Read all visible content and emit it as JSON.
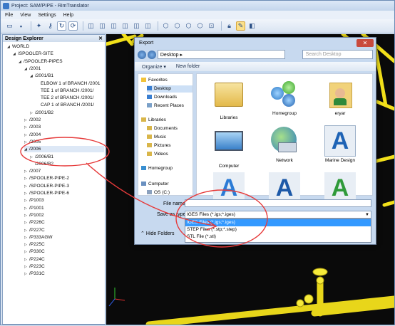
{
  "window": {
    "title": "Project: SAM/PIPE - RimTranslator"
  },
  "menu": [
    "File",
    "View",
    "Settings",
    "Help"
  ],
  "explorer": {
    "title": "Design Explorer",
    "pin": "✕",
    "tree": [
      {
        "label": "WORLD",
        "depth": 0,
        "arrow": "◢"
      },
      {
        "label": "/SPOOLER-SITE",
        "depth": 1,
        "arrow": "◢"
      },
      {
        "label": "/SPOOLER-PIPES",
        "depth": 2,
        "arrow": "◢"
      },
      {
        "label": "/2001",
        "depth": 3,
        "arrow": "◢"
      },
      {
        "label": "/2001/B1",
        "depth": 4,
        "arrow": "◢"
      },
      {
        "label": "ELBOW 1 of BRANCH /2001",
        "depth": 5,
        "arrow": ""
      },
      {
        "label": "TEE 1 of BRANCH /2001/",
        "depth": 5,
        "arrow": ""
      },
      {
        "label": "TEE 2 of BRANCH /2001/",
        "depth": 5,
        "arrow": ""
      },
      {
        "label": "CAP 1 of BRANCH /2001/",
        "depth": 5,
        "arrow": ""
      },
      {
        "label": "/2001/B2",
        "depth": 4,
        "arrow": "▷"
      },
      {
        "label": "/2002",
        "depth": 3,
        "arrow": "▷"
      },
      {
        "label": "/2003",
        "depth": 3,
        "arrow": "▷"
      },
      {
        "label": "/2004",
        "depth": 3,
        "arrow": "▷"
      },
      {
        "label": "/2005",
        "depth": 3,
        "arrow": "▷"
      },
      {
        "label": "/2006",
        "depth": 3,
        "arrow": "◢",
        "selected": true
      },
      {
        "label": "/2006/B1",
        "depth": 4,
        "arrow": "▷"
      },
      {
        "label": "/2006/B2",
        "depth": 4,
        "arrow": ""
      },
      {
        "label": "/2007",
        "depth": 3,
        "arrow": "▷"
      },
      {
        "label": "/SPOOLER-PIPE-2",
        "depth": 3,
        "arrow": "▷"
      },
      {
        "label": "/SPOOLER-PIPE-3",
        "depth": 3,
        "arrow": "▷"
      },
      {
        "label": "/SPOOLER-PIPE-6",
        "depth": 3,
        "arrow": "▷"
      },
      {
        "label": "/P1003",
        "depth": 3,
        "arrow": "▷"
      },
      {
        "label": "/P1001",
        "depth": 3,
        "arrow": "▷"
      },
      {
        "label": "/P1002",
        "depth": 3,
        "arrow": "▷"
      },
      {
        "label": "/P226C",
        "depth": 3,
        "arrow": "▷"
      },
      {
        "label": "/P227C",
        "depth": 3,
        "arrow": "▷"
      },
      {
        "label": "/P333AGW",
        "depth": 3,
        "arrow": "▷"
      },
      {
        "label": "/P225C",
        "depth": 3,
        "arrow": "▷"
      },
      {
        "label": "/P330C",
        "depth": 3,
        "arrow": "▷"
      },
      {
        "label": "/P224C",
        "depth": 3,
        "arrow": "▷"
      },
      {
        "label": "/P223C",
        "depth": 3,
        "arrow": "▷"
      },
      {
        "label": "/P331C",
        "depth": 3,
        "arrow": "▷"
      }
    ]
  },
  "dialog": {
    "title": "Export",
    "close": "✕",
    "address": "Desktop ▸",
    "search_placeholder": "Search Desktop",
    "organize": "Organize ▾",
    "new_folder": "New folder",
    "nav": [
      {
        "label": "Favorites",
        "indent": 0,
        "color": "#f2c33a"
      },
      {
        "label": "Desktop",
        "indent": 1,
        "color": "#3a7fd1",
        "selected": true
      },
      {
        "label": "Downloads",
        "indent": 1,
        "color": "#3a7fd1"
      },
      {
        "label": "Recent Places",
        "indent": 1,
        "color": "#7aa0c8"
      },
      {
        "label": "Libraries",
        "indent": 0,
        "color": "#d9b64a"
      },
      {
        "label": "Documents",
        "indent": 1,
        "color": "#d9b64a"
      },
      {
        "label": "Music",
        "indent": 1,
        "color": "#d9b64a"
      },
      {
        "label": "Pictures",
        "indent": 1,
        "color": "#d9b64a"
      },
      {
        "label": "Videos",
        "indent": 1,
        "color": "#d9b64a"
      },
      {
        "label": "Homegroup",
        "indent": 0,
        "color": "#3a8fd1"
      },
      {
        "label": "Computer",
        "indent": 0,
        "color": "#6a90c0"
      },
      {
        "label": "OS (C:)",
        "indent": 1,
        "color": "#8aa0bd"
      }
    ],
    "files": [
      {
        "label": "Libraries",
        "icon": "libraries-icon"
      },
      {
        "label": "Homegroup",
        "icon": "homegroup-icon"
      },
      {
        "label": "eryar",
        "icon": "user-folder-icon"
      },
      {
        "label": "Computer",
        "icon": "computer-icon"
      },
      {
        "label": "Network",
        "icon": "network-icon"
      },
      {
        "label": "Marine Design",
        "icon": "marine-design-icon"
      },
      {
        "label": "",
        "icon": "app-shortcut-icon"
      },
      {
        "label": "",
        "icon": "app-chart-icon"
      },
      {
        "label": "",
        "icon": "app-green-icon"
      }
    ],
    "file_name_label": "File name:",
    "save_type_label": "Save as type:",
    "save_type_value": "IGES Files (*.igs;*.iges)",
    "save_type_options": [
      "IGES Files (*.igs;*.iges)",
      "STEP Files (*.stp;*.step)",
      "STL File (*.stl)"
    ],
    "hide_folders": "Hide Folders"
  },
  "colors": {
    "pipe": "#f2e01a",
    "background": "#0a0a0a",
    "annotation": "#e63a3a"
  }
}
